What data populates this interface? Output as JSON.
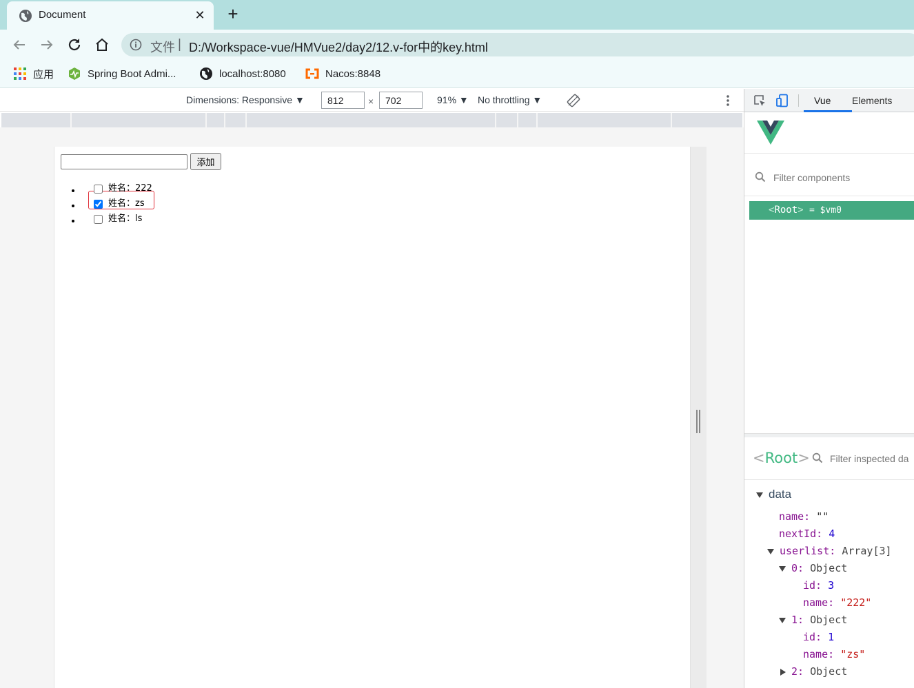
{
  "browser": {
    "tab_title": "Document",
    "close_symbol": "✕",
    "new_tab_symbol": "+",
    "address_scheme": "文件",
    "address_separator": "|",
    "address_url": "D:/Workspace-vue/HMVue2/day2/12.v-for中的key.html",
    "bookmarks": [
      {
        "label": "应用",
        "icon": "apps-grid-icon"
      },
      {
        "label": "Spring Boot Admi...",
        "icon": "spring-boot-admin-icon"
      },
      {
        "label": "localhost:8080",
        "icon": "globe-icon"
      },
      {
        "label": "Nacos:8848",
        "icon": "nacos-icon"
      }
    ]
  },
  "device_toolbar": {
    "dimensions_label": "Dimensions: Responsive ▼",
    "width": "812",
    "times": "×",
    "height": "702",
    "zoom": "91% ▼",
    "throttling": "No throttling ▼"
  },
  "page": {
    "input_value": "",
    "add_button": "添加",
    "users": [
      {
        "label": "姓名：222",
        "checked": false
      },
      {
        "label": "姓名：zs",
        "checked": true
      },
      {
        "label": "姓名：ls",
        "checked": false
      }
    ]
  },
  "devtools": {
    "tabs": [
      "Vue",
      "Elements"
    ],
    "active_tab": "Vue",
    "filter_components_placeholder": "Filter components",
    "root_tree_item": {
      "open": "<",
      "name": "Root",
      "close": ">",
      "vm": "= $vm0"
    },
    "inspect": {
      "root_open": "<",
      "root_name": "Root",
      "root_close": ">",
      "filter_placeholder": "Filter inspected da",
      "section": "data",
      "fields": {
        "name_key": "name:",
        "name_val": "\"\"",
        "nextId_key": "nextId:",
        "nextId_val": "4",
        "userlist_key": "userlist:",
        "userlist_val": "Array[3]",
        "item0_key": "0:",
        "item0_val": "Object",
        "item0_id_key": "id:",
        "item0_id_val": "3",
        "item0_name_key": "name:",
        "item0_name_val": "\"222\"",
        "item1_key": "1:",
        "item1_val": "Object",
        "item1_id_key": "id:",
        "item1_id_val": "1",
        "item1_name_key": "name:",
        "item1_name_val": "\"zs\"",
        "item2_key": "2:",
        "item2_val": "Object"
      }
    },
    "colors": {
      "vue_green": "#42b983",
      "selected_row": "#44a981",
      "active_tab_underline": "#1a73e8"
    }
  }
}
